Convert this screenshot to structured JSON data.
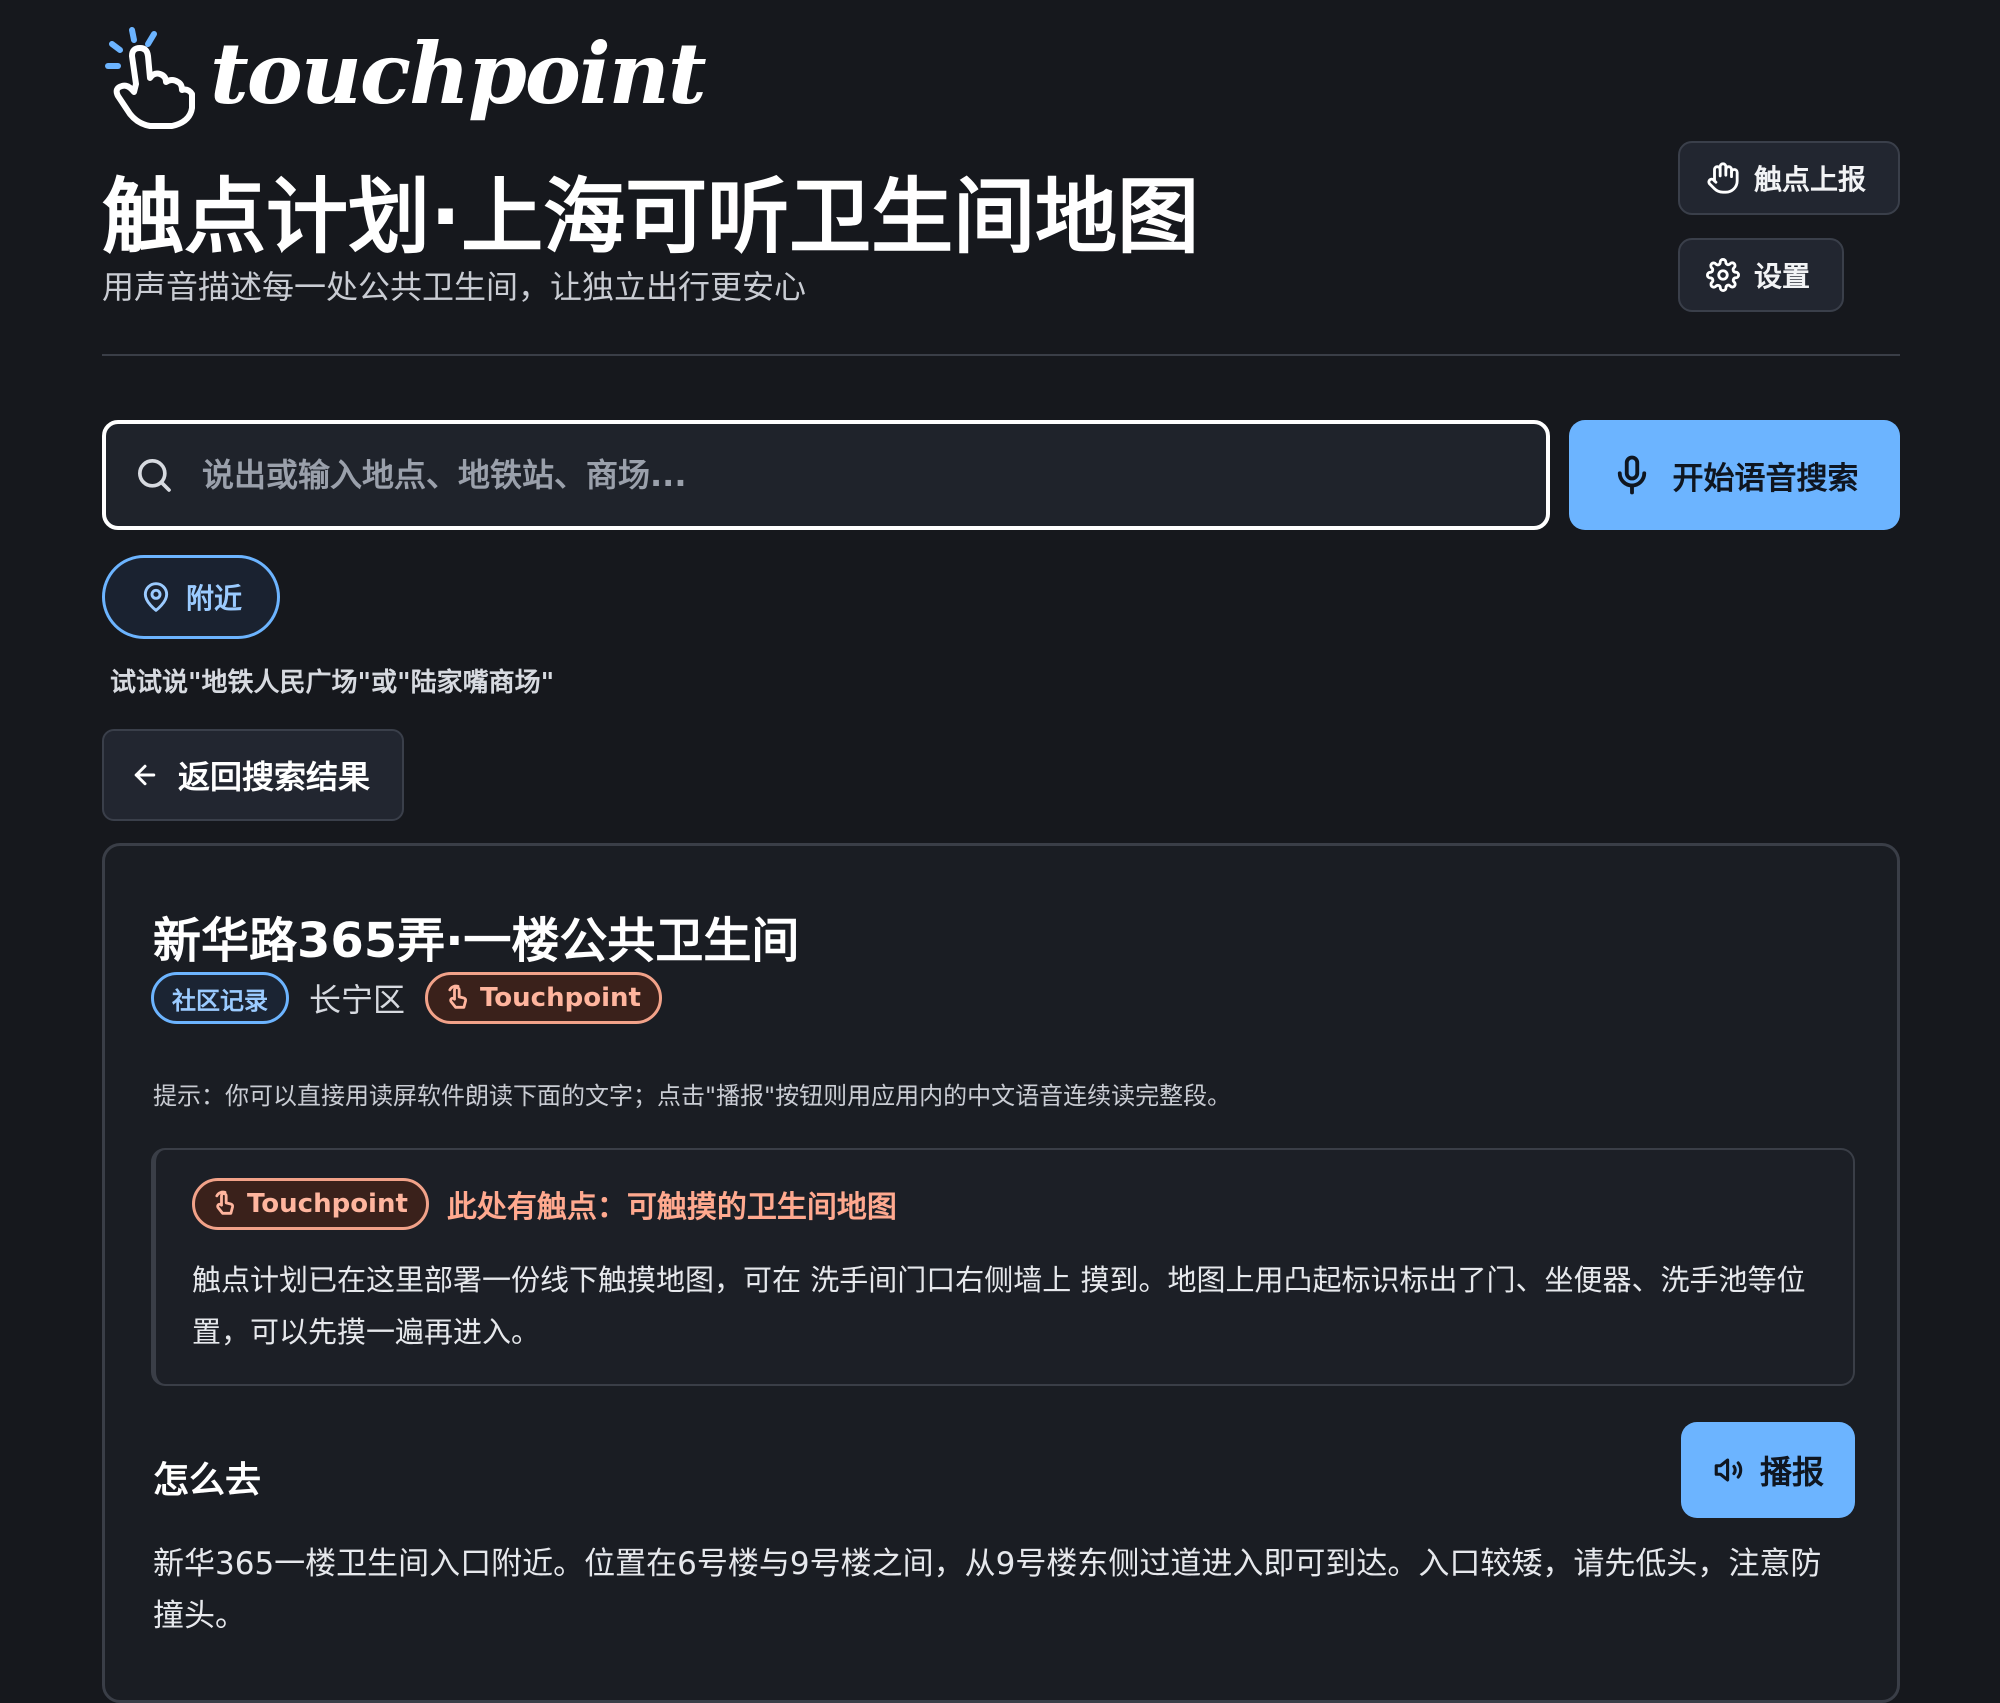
{
  "brand": {
    "logo_text": "touchpoint",
    "logo_icon": "pointing-hand-icon"
  },
  "header": {
    "title": "触点计划·上海可听卫生间地图",
    "subtitle": "用声音描述每一处公共卫生间，让独立出行更安心",
    "report_label": "触点上报",
    "settings_label": "设置"
  },
  "search": {
    "placeholder": "说出或输入地点、地铁站、商场...",
    "value": "",
    "voice_label": "开始语音搜索",
    "nearby_label": "附近",
    "try_hint": "试试说\"地铁人民广场\"或\"陆家嘴商场\""
  },
  "back_label": "返回搜索结果",
  "detail": {
    "title": "新华路365弄·一楼公共卫生间",
    "tag_community": "社区记录",
    "district": "长宁区",
    "tag_touchpoint": "Touchpoint",
    "tip": "提示：你可以直接用读屏软件朗读下面的文字；点击\"播报\"按钮则用应用内的中文语音连续读完整段。",
    "touchpoint_box": {
      "badge": "Touchpoint",
      "heading": "此处有触点：可触摸的卫生间地图",
      "body": "触点计划已在这里部署一份线下触摸地图，可在 洗手间门口右侧墙上 摸到。地图上用凸起标识标出了门、坐便器、洗手池等位置，可以先摸一遍再进入。"
    },
    "how_to_get_title": "怎么去",
    "play_label": "播报",
    "how_to_get_body": "新华365一楼卫生间入口附近。位置在6号楼与9号楼之间，从9号楼东侧过道进入即可到达。入口较矮，请先低头，注意防撞头。"
  },
  "colors": {
    "background": "#16181d",
    "accent_blue": "#6cb4ff",
    "touchpoint_orange": "#ffa98f"
  }
}
